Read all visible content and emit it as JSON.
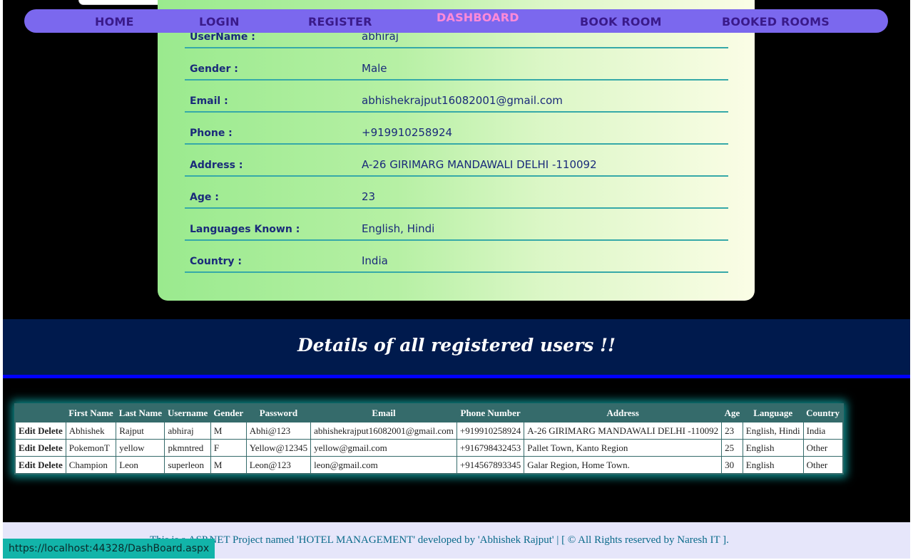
{
  "nav": {
    "items": [
      "HOME",
      "LOGIN",
      "REGISTER",
      "DASHBOARD",
      "BOOK ROOM",
      "BOOKED ROOMS"
    ],
    "active": "DASHBOARD"
  },
  "profile": {
    "rows": [
      {
        "label": "UserName :",
        "value": "abhiraj"
      },
      {
        "label": "Gender :",
        "value": "Male"
      },
      {
        "label": "Email :",
        "value": "abhishekrajput16082001@gmail.com"
      },
      {
        "label": "Phone :",
        "value": "+919910258924"
      },
      {
        "label": "Address :",
        "value": "A-26 GIRIMARG MANDAWALI DELHI -110092"
      },
      {
        "label": "Age :",
        "value": "23"
      },
      {
        "label": "Languages Known :",
        "value": "English, Hindi"
      },
      {
        "label": "Country :",
        "value": "India"
      }
    ]
  },
  "banner": {
    "title": "Details of all registered users !!"
  },
  "users_table": {
    "headers": [
      "",
      "First Name",
      "Last Name",
      "Username",
      "Gender",
      "Password",
      "Email",
      "Phone Number",
      "Address",
      "Age",
      "Language",
      "Country"
    ],
    "edit_label": "Edit",
    "delete_label": "Delete",
    "rows": [
      [
        "Abhishek",
        "Rajput",
        "abhiraj",
        "M",
        "Abhi@123",
        "abhishekrajput16082001@gmail.com",
        "+919910258924",
        "A-26 GIRIMARG MANDAWALI DELHI -110092",
        "23",
        "English, Hindi",
        "India"
      ],
      [
        "PokemonT",
        "yellow",
        "pkmntred",
        "F",
        "Yellow@12345",
        "yellow@gmail.com",
        "+916798432453",
        "Pallet Town, Kanto Region",
        "25",
        "English",
        "Other"
      ],
      [
        "Champion",
        "Leon",
        "superleon",
        "M",
        "Leon@123",
        "leon@gmail.com",
        "+914567893345",
        "Galar Region, Home Town.",
        "30",
        "English",
        "Other"
      ]
    ]
  },
  "footer": {
    "text": "This is a ASP.NET Project named 'HOTEL MANAGEMENT' developed by 'Abhishek Rajput' | [ © All Rights reserved by Naresh IT ]."
  },
  "statusbar": {
    "url": "https://localhost:44328/DashBoard.aspx"
  },
  "colors": {
    "nav_bg": "#7b68ee",
    "nav_text": "#3a1a8a",
    "nav_active": "#ff8ad8",
    "banner_bg": "#001a4d",
    "table_header_bg": "#356b6b",
    "status_bg": "#12b4a9"
  }
}
